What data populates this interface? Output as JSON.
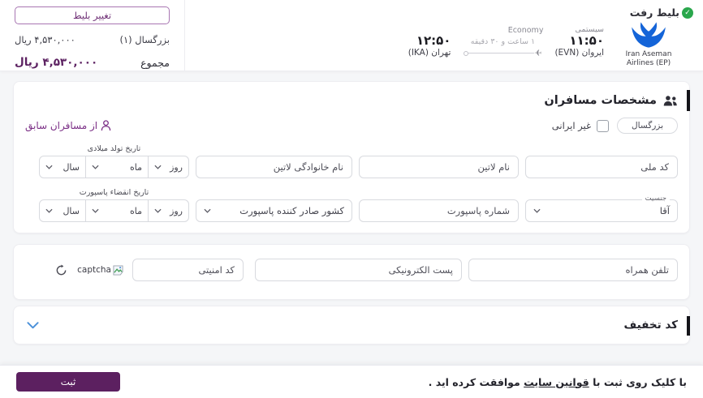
{
  "top": {
    "price_panel": {
      "change_ticket_label": "تغییر بلیط",
      "adult_label": "بزرگسال (۱)",
      "adult_price": "۴,۵۳۰,۰۰۰ ریال",
      "total_label": "مجموع",
      "total_price": "۴,۵۳۰,۰۰۰ ریال"
    },
    "flight": {
      "ticket_type": "بلیط رفت",
      "airline_name": "Iran Aseman Airlines (EP)",
      "fare_type": "سیستمی",
      "departure_time": "۱۱:۵۰",
      "departure_city": "ایروان (EVN)",
      "cabin": "Economy",
      "duration": "۱ ساعت و ۳۰ دقیقه",
      "arrival_time": "۱۲:۵۰",
      "arrival_city": "تهران (IKA)"
    }
  },
  "passengers": {
    "title": "مشخصات مسافران",
    "adult_chip": "بزرگسال",
    "non_iranian_label": "غیر ایرانی",
    "previous_passengers_link": "از مسافران سابق",
    "fields": {
      "national_code": "کد ملی",
      "first_name_latin": "نام لاتین",
      "last_name_latin": "نام خانوادگی لاتین",
      "birth_date_label": "تاریخ تولد میلادی",
      "day": "روز",
      "month": "ماه",
      "year": "سال",
      "gender_label": "جنسیت",
      "gender_value": "آقا",
      "passport_number": "شماره پاسپورت",
      "passport_country": "کشور صادر کننده پاسپورت",
      "passport_expiry_label": "تاریخ انقضاء پاسپورت"
    }
  },
  "contact": {
    "mobile_placeholder": "تلفن همراه",
    "email_placeholder": "پست الکترونیکی",
    "security_code_placeholder": "کد امنیتی",
    "captcha_alt": "captcha"
  },
  "discount": {
    "title": "کد تخفیف"
  },
  "footer": {
    "agreement_prefix": "با کلیک روی ثبت با ",
    "agreement_link": "قوانین سایت",
    "agreement_suffix": " موافقت کرده اید .",
    "submit_label": "ثبت"
  },
  "colors": {
    "primary_purple": "#5c2060",
    "link_purple": "#7b2f86",
    "accent_blue": "#4a90d9",
    "success_green": "#2aa74c",
    "logo_blue": "#1464d8"
  }
}
